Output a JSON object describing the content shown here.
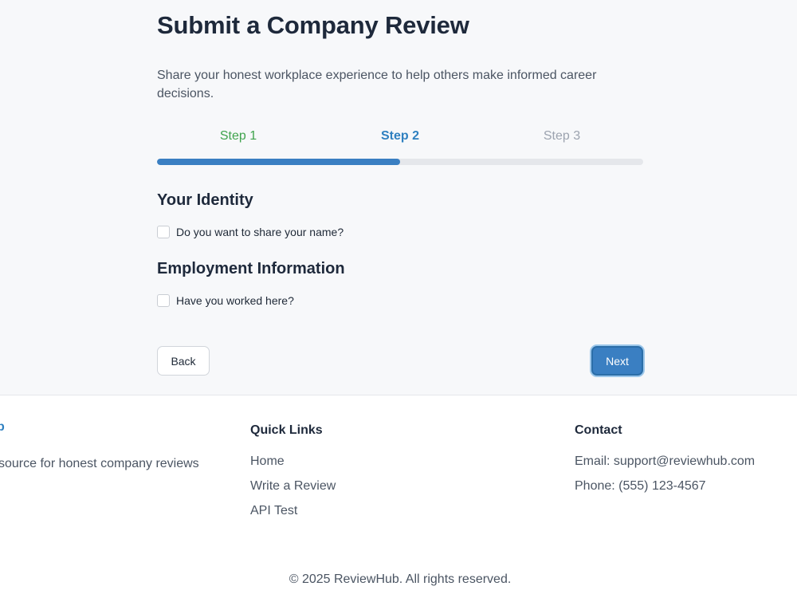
{
  "form": {
    "title": "Submit a Company Review",
    "subtitle": "Share your honest workplace experience to help others make informed career decisions.",
    "steps": [
      {
        "label": "Step 1",
        "state": "completed"
      },
      {
        "label": "Step 2",
        "state": "current"
      },
      {
        "label": "Step 3",
        "state": "upcoming"
      }
    ],
    "progress": 0.5,
    "sections": {
      "identity": {
        "heading": "Your Identity",
        "checkbox_label": "Do you want to share your name?",
        "checked": false
      },
      "employment": {
        "heading": "Employment Information",
        "checkbox_label": "Have you worked here?",
        "checked": false
      }
    },
    "buttons": {
      "back": "Back",
      "next": "Next"
    }
  },
  "footer": {
    "brand_fragment": "b",
    "tagline": "source for honest company reviews",
    "quick_links": {
      "heading": "Quick Links",
      "items": [
        "Home",
        "Write a Review",
        "API Test"
      ]
    },
    "contact": {
      "heading": "Contact",
      "items": [
        "Email: support@reviewhub.com",
        "Phone: (555) 123-4567"
      ]
    },
    "copyright": "© 2025 ReviewHub. All rights reserved."
  },
  "colors": {
    "accent": "#3a7fc2",
    "step_completed": "#3fa34d",
    "step_current": "#2f80c0",
    "step_upcoming": "#9ca3af",
    "progress_track": "#e5e7eb",
    "page_background": "#f7f8fa"
  }
}
